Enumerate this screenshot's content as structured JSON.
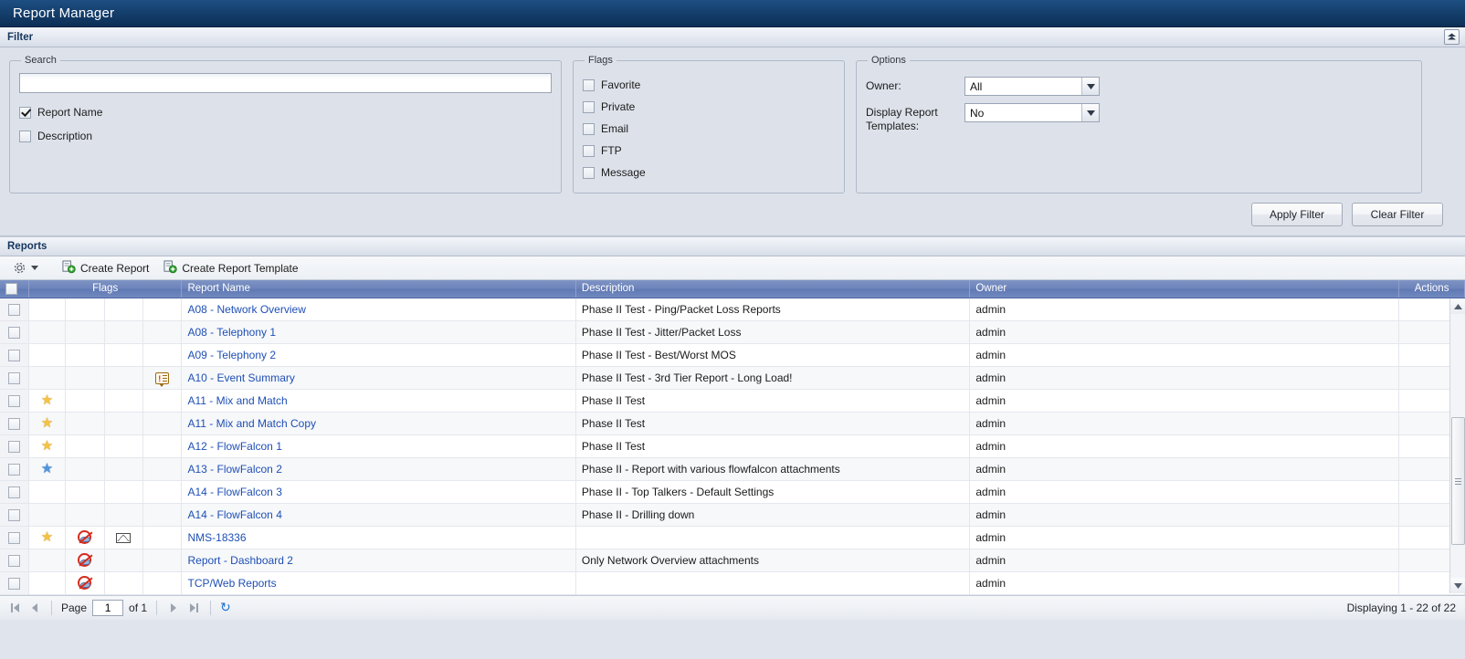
{
  "window": {
    "title": "Report Manager"
  },
  "filter": {
    "header": "Filter",
    "collapse_icon": "collapse-up-icon",
    "search": {
      "legend": "Search",
      "input_value": "",
      "input_placeholder": "",
      "checkboxes": [
        {
          "label": "Report Name",
          "checked": true
        },
        {
          "label": "Description",
          "checked": false
        }
      ]
    },
    "flags": {
      "legend": "Flags",
      "checkboxes": [
        {
          "label": "Favorite",
          "checked": false
        },
        {
          "label": "Private",
          "checked": false
        },
        {
          "label": "Email",
          "checked": false
        },
        {
          "label": "FTP",
          "checked": false
        },
        {
          "label": "Message",
          "checked": false
        }
      ]
    },
    "options": {
      "legend": "Options",
      "owner_label": "Owner:",
      "owner_value": "All",
      "templates_label": "Display Report Templates:",
      "templates_value": "No"
    },
    "apply_label": "Apply Filter",
    "clear_label": "Clear Filter"
  },
  "reports": {
    "header": "Reports",
    "toolbar": {
      "gear_icon": "gear-icon",
      "caret_icon": "chevron-down-icon",
      "create_report": "Create Report",
      "create_report_template": "Create Report Template"
    },
    "columns": {
      "select": "",
      "flags": "Flags",
      "name": "Report Name",
      "description": "Description",
      "owner": "Owner",
      "actions": "Actions"
    },
    "rows": [
      {
        "favorite": "",
        "private": "",
        "email": "",
        "ftp": "",
        "message": "",
        "name": "A08 - Network Overview",
        "description": "Phase II Test - Ping/Packet Loss Reports",
        "owner": "admin",
        "actions": ""
      },
      {
        "favorite": "",
        "private": "",
        "email": "",
        "ftp": "",
        "message": "",
        "name": "A08 - Telephony 1",
        "description": "Phase II Test - Jitter/Packet Loss",
        "owner": "admin",
        "actions": ""
      },
      {
        "favorite": "",
        "private": "",
        "email": "",
        "ftp": "",
        "message": "",
        "name": "A09 - Telephony 2",
        "description": "Phase II Test - Best/Worst MOS",
        "owner": "admin",
        "actions": ""
      },
      {
        "favorite": "",
        "private": "",
        "email": "",
        "ftp": "",
        "message": "message-icon",
        "name": "A10 - Event Summary",
        "description": "Phase II Test - 3rd Tier Report - Long Load!",
        "owner": "admin",
        "actions": ""
      },
      {
        "favorite": "star-gold-icon",
        "private": "",
        "email": "",
        "ftp": "",
        "message": "",
        "name": "A11 - Mix and Match",
        "description": "Phase II Test",
        "owner": "admin",
        "actions": ""
      },
      {
        "favorite": "star-gold-icon",
        "private": "",
        "email": "",
        "ftp": "",
        "message": "",
        "name": "A11 - Mix and Match Copy",
        "description": "Phase II Test",
        "owner": "admin",
        "actions": ""
      },
      {
        "favorite": "star-gold-icon",
        "private": "",
        "email": "",
        "ftp": "",
        "message": "",
        "name": "A12 - FlowFalcon 1",
        "description": "Phase II Test",
        "owner": "admin",
        "actions": ""
      },
      {
        "favorite": "star-blue-icon",
        "private": "",
        "email": "",
        "ftp": "",
        "message": "",
        "name": "A13 - FlowFalcon 2",
        "description": "Phase II - Report with various flowfalcon attachments",
        "owner": "admin",
        "actions": ""
      },
      {
        "favorite": "",
        "private": "",
        "email": "",
        "ftp": "",
        "message": "",
        "name": "A14 - FlowFalcon 3",
        "description": "Phase II - Top Talkers - Default Settings",
        "owner": "admin",
        "actions": ""
      },
      {
        "favorite": "",
        "private": "",
        "email": "",
        "ftp": "",
        "message": "",
        "name": "A14 - FlowFalcon 4",
        "description": "Phase II - Drilling down",
        "owner": "admin",
        "actions": ""
      },
      {
        "favorite": "star-gold-icon",
        "private": "private-icon",
        "email": "email-icon",
        "ftp": "",
        "message": "",
        "name": "NMS-18336",
        "description": "",
        "owner": "admin",
        "actions": ""
      },
      {
        "favorite": "",
        "private": "private-icon",
        "email": "",
        "ftp": "",
        "message": "",
        "name": "Report - Dashboard 2",
        "description": "Only Network Overview attachments",
        "owner": "admin",
        "actions": ""
      },
      {
        "favorite": "",
        "private": "private-icon",
        "email": "",
        "ftp": "",
        "message": "",
        "name": "TCP/Web Reports",
        "description": "",
        "owner": "admin",
        "actions": ""
      }
    ]
  },
  "pager": {
    "first_icon": "first-page-icon",
    "prev_icon": "prev-page-icon",
    "page_label": "Page",
    "page_value": "1",
    "of_label": "of 1",
    "next_icon": "next-page-icon",
    "last_icon": "last-page-icon",
    "refresh_icon": "refresh-icon",
    "status": "Displaying 1 - 22 of 22"
  },
  "colors": {
    "title_bar": "#15406e",
    "grid_header": "#6c83ba",
    "link": "#1f4fb5",
    "panel_bg": "#dde2ea"
  }
}
